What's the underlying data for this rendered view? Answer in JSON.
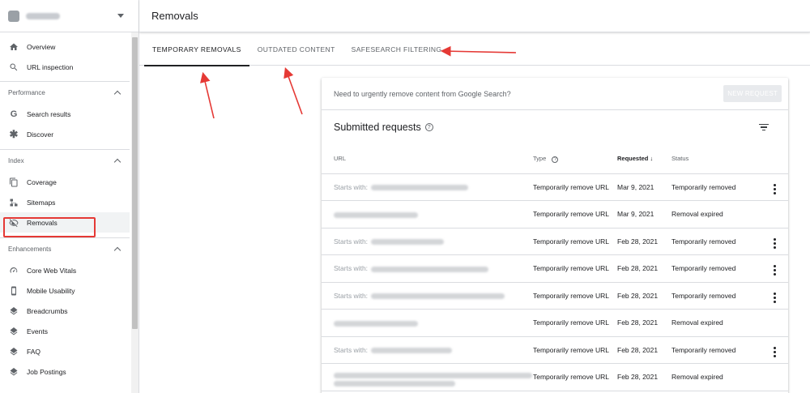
{
  "sidebar": {
    "property": {
      "name": "",
      "icon": "property-favicon"
    },
    "top_items": [
      {
        "label": "Overview",
        "icon": "home-icon"
      },
      {
        "label": "URL inspection",
        "icon": "search-icon"
      }
    ],
    "sections": [
      {
        "label": "Performance",
        "items": [
          {
            "label": "Search results",
            "icon": "google-g-icon"
          },
          {
            "label": "Discover",
            "icon": "asterisk-icon"
          }
        ]
      },
      {
        "label": "Index",
        "items": [
          {
            "label": "Coverage",
            "icon": "file-copy-icon"
          },
          {
            "label": "Sitemaps",
            "icon": "sitemap-icon"
          },
          {
            "label": "Removals",
            "icon": "eye-off-icon",
            "active": true
          }
        ]
      },
      {
        "label": "Enhancements",
        "items": [
          {
            "label": "Core Web Vitals",
            "icon": "speed-gauge-icon"
          },
          {
            "label": "Mobile Usability",
            "icon": "smartphone-icon"
          },
          {
            "label": "Breadcrumbs",
            "icon": "layers-icon"
          },
          {
            "label": "Events",
            "icon": "layers-icon"
          },
          {
            "label": "FAQ",
            "icon": "layers-icon"
          },
          {
            "label": "Job Postings",
            "icon": "layers-icon"
          }
        ]
      }
    ]
  },
  "header": {
    "title": "Removals"
  },
  "tabs": [
    {
      "label": "TEMPORARY REMOVALS",
      "active": true
    },
    {
      "label": "OUTDATED CONTENT",
      "active": false
    },
    {
      "label": "SAFESEARCH FILTERING",
      "active": false
    }
  ],
  "card": {
    "urgent_text": "Need to urgently remove content from Google Search?",
    "new_request_label": "NEW REQUEST",
    "submitted_title": "Submitted requests",
    "columns": {
      "url": "URL",
      "type": "Type",
      "requested": "Requested",
      "status": "Status"
    },
    "rows": [
      {
        "prefix": "Starts with:",
        "type": "Temporarily remove URL",
        "requested": "Mar 9, 2021",
        "status": "Temporarily removed",
        "menu": true
      },
      {
        "prefix": "",
        "type": "Temporarily remove URL",
        "requested": "Mar 9, 2021",
        "status": "Removal expired",
        "menu": false
      },
      {
        "prefix": "Starts with:",
        "type": "Temporarily remove URL",
        "requested": "Feb 28, 2021",
        "status": "Temporarily removed",
        "menu": true
      },
      {
        "prefix": "Starts with:",
        "type": "Temporarily remove URL",
        "requested": "Feb 28, 2021",
        "status": "Temporarily removed",
        "menu": true
      },
      {
        "prefix": "Starts with:",
        "type": "Temporarily remove URL",
        "requested": "Feb 28, 2021",
        "status": "Temporarily removed",
        "menu": true
      },
      {
        "prefix": "",
        "type": "Temporarily remove URL",
        "requested": "Feb 28, 2021",
        "status": "Removal expired",
        "menu": false
      },
      {
        "prefix": "Starts with:",
        "type": "Temporarily remove URL",
        "requested": "Feb 28, 2021",
        "status": "Temporarily removed",
        "menu": true
      },
      {
        "prefix": "",
        "type": "Temporarily remove URL",
        "requested": "Feb 28, 2021",
        "status": "Removal expired",
        "menu": false
      }
    ]
  },
  "colors": {
    "annotation": "#e53935",
    "active_nav_bg": "#f1f3f4",
    "divider": "#dadce0"
  }
}
